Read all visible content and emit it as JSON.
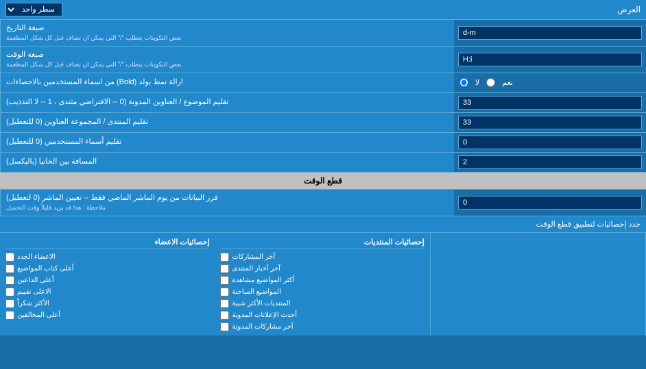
{
  "title": "العرض",
  "rows": [
    {
      "id": "display-row",
      "label": "العرض",
      "control": "select",
      "value": "سطر واحد"
    },
    {
      "id": "date-format",
      "label": "صيغة التاريخ",
      "sublabel": "بعض التكوينات يتطلب \"/\" التي يمكن ان تضاف قبل كل شكل المطعمة",
      "control": "text",
      "value": "d-m"
    },
    {
      "id": "time-format",
      "label": "صيغة الوقت",
      "sublabel": "بعض التكوينات يتطلب \"/\" التي يمكن ان تضاف قبل كل شكل المطعمة",
      "control": "text",
      "value": "H:i"
    },
    {
      "id": "remove-bold",
      "label": "ازالة نمط بولد (Bold) من اسماء المستخدمين بالاحصاءات",
      "control": "radio",
      "options": [
        "نعم",
        "لا"
      ],
      "selected": "لا"
    },
    {
      "id": "topic-order",
      "label": "تقليم الموضوع / العناوين المدونة (0 -- الافتراضي مثتدى ، 1 -- لا التذذيب)",
      "control": "text",
      "value": "33"
    },
    {
      "id": "forum-order",
      "label": "تقليم المنتدى / المجموعة العناوين (0 للتعطيل)",
      "control": "text",
      "value": "33"
    },
    {
      "id": "username-trim",
      "label": "تقليم أسماء المستخدمين (0 للتعطيل)",
      "control": "text",
      "value": "0"
    },
    {
      "id": "space-between",
      "label": "المسافة بين الخانيا (بالبكسل)",
      "control": "text",
      "value": "2"
    }
  ],
  "cut-time-section": {
    "header": "قطع الوقت",
    "row": {
      "id": "cut-time",
      "label": "فرز البيانات من يوم الماشر الماضي فقط -- تعيين الماشر (0 لتعطيل)",
      "note": "ملاحظة : هذا قد يزيد قليلاً وقت التحميل",
      "control": "text",
      "value": "0"
    }
  },
  "stats-section": {
    "header": "حدد إحصائيات لتطبيق قطع الوقت",
    "col1": {
      "header": "",
      "items": []
    },
    "col2": {
      "header": "إحصائيات المنتديات",
      "items": [
        "آخر المشاركات",
        "آخر أخبار المنتدى",
        "أكثر المواضيع مشاهدة",
        "المواضيع الساخنة",
        "المنتديات الأكثر شبية",
        "أحدث الإعلانات المدونة",
        "آخر مشاركات المدونة"
      ]
    },
    "col3": {
      "header": "إحصائيات الاعضاء",
      "items": [
        "الاعضاء الجدد",
        "أعلى كتاب المواضيع",
        "أعلى الداعين",
        "الاعلى تقييم",
        "الأكثر شكراً",
        "أعلى المخالفين"
      ]
    }
  }
}
